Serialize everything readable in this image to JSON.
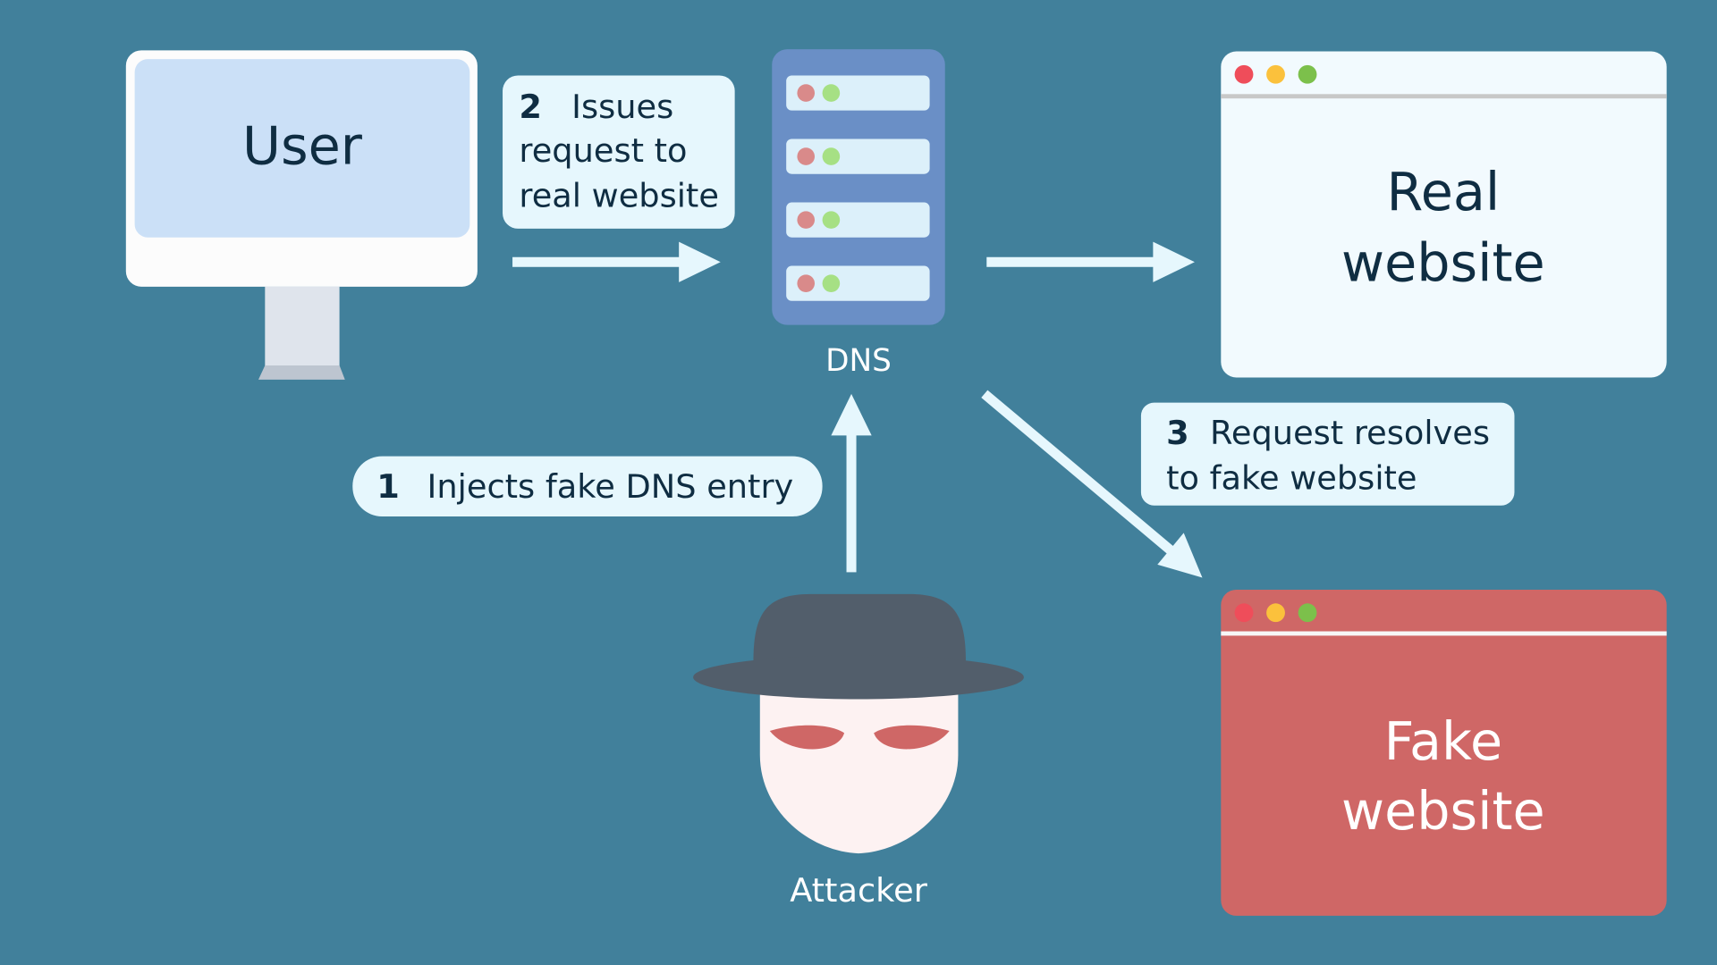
{
  "colors": {
    "background": "#41809b",
    "bubble": "#e6f7fd",
    "server": "#6a8fc6",
    "fake_site": "#cf6766",
    "real_site": "#f2fafe",
    "text_dark": "#0f2d42"
  },
  "user": {
    "label": "User"
  },
  "dns": {
    "label": "DNS"
  },
  "attacker": {
    "label": "Attacker"
  },
  "real_site": {
    "line1": "Real",
    "line2": "website"
  },
  "fake_site": {
    "line1": "Fake",
    "line2": "website"
  },
  "steps": [
    {
      "number": "1",
      "lines": [
        "Injects fake DNS entry"
      ]
    },
    {
      "number": "2",
      "lines": [
        "Issues",
        "request to",
        "real website"
      ]
    },
    {
      "number": "3",
      "lines": [
        "Request resolves",
        "to fake website"
      ]
    }
  ]
}
